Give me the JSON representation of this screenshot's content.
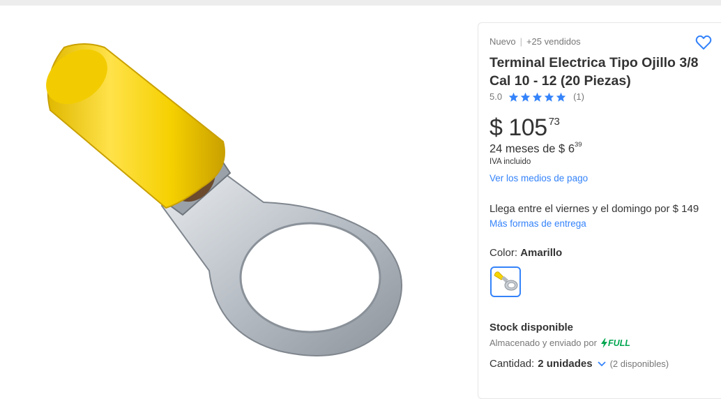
{
  "product": {
    "condition": "Nuevo",
    "separator": "|",
    "sold": "+25 vendidos",
    "title": "Terminal Electrica Tipo Ojillo 3/8 Cal 10 - 12 (20 Piezas)",
    "rating_value": "5.0",
    "rating_count": "(1)",
    "stars": 5,
    "price_currency": "$",
    "price_integer": "105",
    "price_cents": "73",
    "installments_text": "24 meses de $ 6",
    "installments_cents": "39",
    "tax_note": "IVA incluido",
    "payment_link": "Ver los medios de pago",
    "shipping_text": "Llega entre el viernes y el domingo por $ 149",
    "shipping_link": "Más formas de entrega",
    "color_label": "Color: ",
    "color_value": "Amarillo",
    "stock_text": "Stock disponible",
    "stored_text": "Almacenado y enviado por",
    "full_label": "FULL",
    "quantity_label": "Cantidad:",
    "quantity_value": "2 unidades",
    "quantity_available": "(2 disponibles)"
  },
  "colors": {
    "accent": "#3483fa",
    "full_green": "#00a650",
    "terminal_yellow": "#f5d400",
    "terminal_metal": "#c8cdd3"
  }
}
